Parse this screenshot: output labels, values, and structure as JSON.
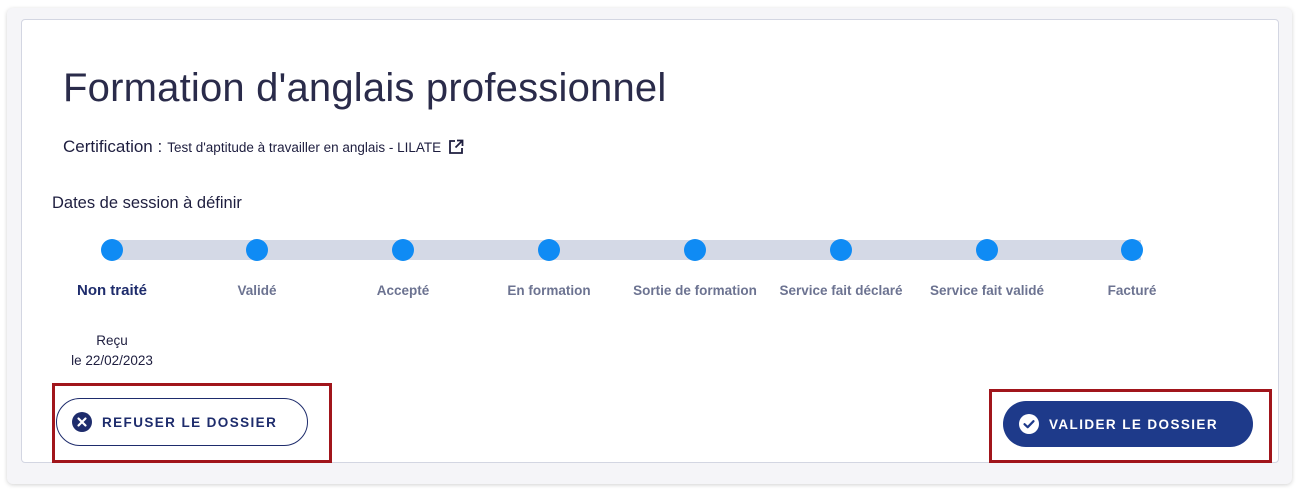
{
  "title": "Formation d'anglais professionnel",
  "certification": {
    "label": "Certification :",
    "value": "Test d'aptitude à travailler en anglais - LILATE",
    "icon": "external-link-icon"
  },
  "session_dates": "Dates de session à définir",
  "steps": [
    {
      "label": "Non traité",
      "status": "current",
      "sub1": "Reçu",
      "sub2": "le 22/02/2023"
    },
    {
      "label": "Validé"
    },
    {
      "label": "Accepté"
    },
    {
      "label": "En formation"
    },
    {
      "label": "Sortie de formation"
    },
    {
      "label": "Service fait déclaré"
    },
    {
      "label": "Service fait validé"
    },
    {
      "label": "Facturé"
    }
  ],
  "actions": {
    "refuse": {
      "label": "REFUSER LE DOSSIER",
      "icon": "close-circle-icon"
    },
    "validate": {
      "label": "VALIDER LE DOSSIER",
      "icon": "check-circle-icon"
    }
  },
  "colors": {
    "primary": "#1e3a8a",
    "step_dot": "#0f8bf4",
    "track": "#d4d9e6",
    "highlight": "#a1151b"
  }
}
